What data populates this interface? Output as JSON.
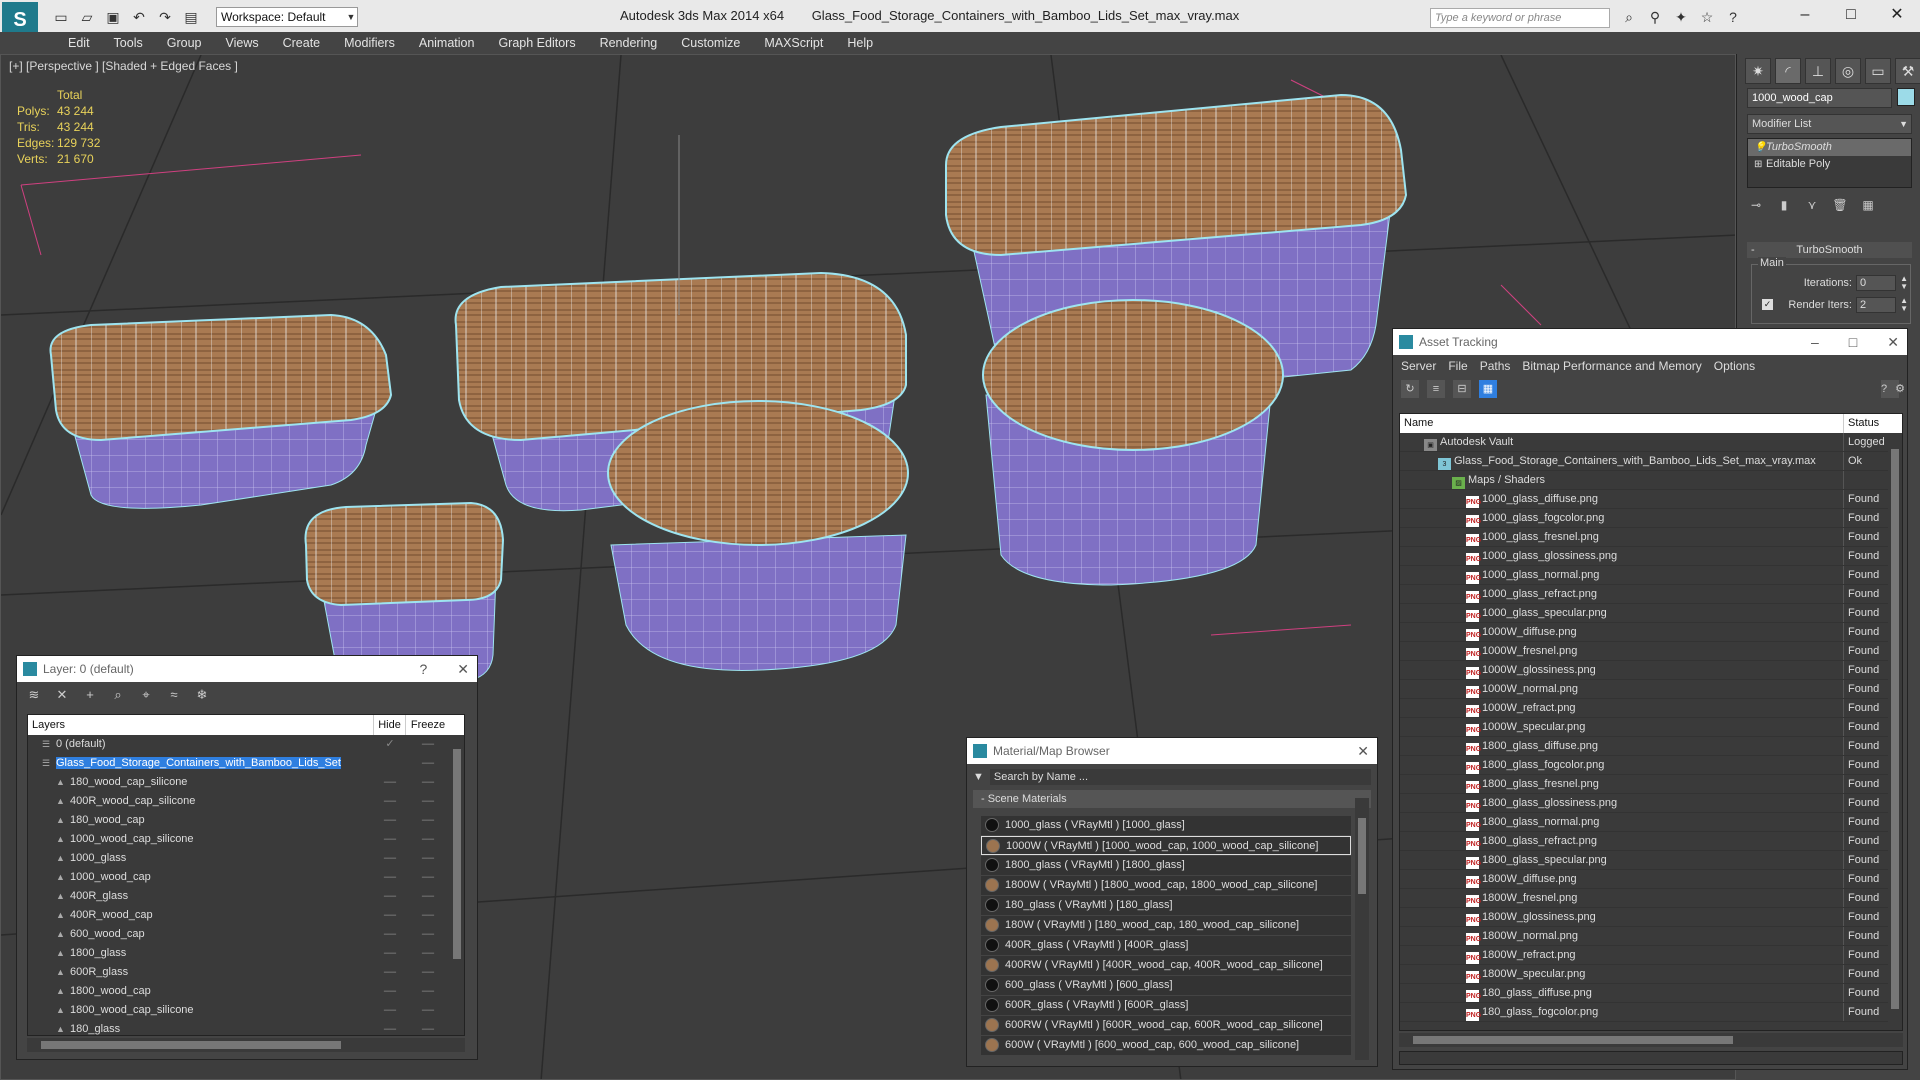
{
  "titlebar": {
    "workspace": "Workspace: Default",
    "app_title": "Autodesk 3ds Max  2014 x64",
    "file_title": "Glass_Food_Storage_Containers_with_Bamboo_Lids_Set_max_vray.max",
    "search_placeholder": "Type a keyword or phrase"
  },
  "menu": [
    "Edit",
    "Tools",
    "Group",
    "Views",
    "Create",
    "Modifiers",
    "Animation",
    "Graph Editors",
    "Rendering",
    "Customize",
    "MAXScript",
    "Help"
  ],
  "viewport": {
    "label": "[+] [Perspective ] [Shaded + Edged Faces ]",
    "stats_header": "Total",
    "stats": [
      {
        "k": "Polys:",
        "v": "43 244"
      },
      {
        "k": "Tris:",
        "v": "43 244"
      },
      {
        "k": "Edges:",
        "v": "129 732"
      },
      {
        "k": "Verts:",
        "v": "21 670"
      }
    ]
  },
  "command_panel": {
    "object_name": "1000_wood_cap",
    "object_color": "#9cdbe8",
    "modifier_list": "Modifier List",
    "stack": [
      "TurboSmooth",
      "Editable Poly"
    ],
    "rollout": "TurboSmooth",
    "group": "Main",
    "iterations_label": "Iterations:",
    "iterations": "0",
    "render_iters_label": "Render Iters:",
    "render_iters": "2"
  },
  "layer_window": {
    "title": "Layer: 0 (default)",
    "help": "?",
    "close": "✕",
    "col_layers": "Layers",
    "col_hide": "Hide",
    "col_freeze": "Freeze",
    "rows": [
      {
        "name": "0 (default)",
        "level": 1,
        "hide": "✓",
        "freeze": ""
      },
      {
        "name": "Glass_Food_Storage_Containers_with_Bamboo_Lids_Set",
        "level": 1,
        "selected": true,
        "hide": "",
        "freeze": ""
      },
      {
        "name": "180_wood_cap_silicone",
        "level": 2
      },
      {
        "name": "400R_wood_cap_silicone",
        "level": 2
      },
      {
        "name": "180_wood_cap",
        "level": 2
      },
      {
        "name": "1000_wood_cap_silicone",
        "level": 2
      },
      {
        "name": "1000_glass",
        "level": 2
      },
      {
        "name": "1000_wood_cap",
        "level": 2
      },
      {
        "name": "400R_glass",
        "level": 2
      },
      {
        "name": "400R_wood_cap",
        "level": 2
      },
      {
        "name": "600_wood_cap",
        "level": 2
      },
      {
        "name": "1800_glass",
        "level": 2
      },
      {
        "name": "600R_glass",
        "level": 2
      },
      {
        "name": "1800_wood_cap",
        "level": 2
      },
      {
        "name": "1800_wood_cap_silicone",
        "level": 2
      },
      {
        "name": "180_glass",
        "level": 2
      }
    ]
  },
  "material_browser": {
    "title": "Material/Map Browser",
    "search": "Search by Name ...",
    "section": "- Scene Materials",
    "items": [
      {
        "label": "1000_glass  ( VRayMtl ) [1000_glass]",
        "wood": false
      },
      {
        "label": "1000W  ( VRayMtl ) [1000_wood_cap, 1000_wood_cap_silicone]",
        "wood": true,
        "selected": true
      },
      {
        "label": "1800_glass  ( VRayMtl ) [1800_glass]",
        "wood": false
      },
      {
        "label": "1800W  ( VRayMtl ) [1800_wood_cap, 1800_wood_cap_silicone]",
        "wood": true
      },
      {
        "label": "180_glass  ( VRayMtl ) [180_glass]",
        "wood": false
      },
      {
        "label": "180W  ( VRayMtl ) [180_wood_cap, 180_wood_cap_silicone]",
        "wood": true
      },
      {
        "label": "400R_glass  ( VRayMtl ) [400R_glass]",
        "wood": false
      },
      {
        "label": "400RW  ( VRayMtl ) [400R_wood_cap, 400R_wood_cap_silicone]",
        "wood": true
      },
      {
        "label": "600_glass  ( VRayMtl ) [600_glass]",
        "wood": false
      },
      {
        "label": "600R_glass  ( VRayMtl ) [600R_glass]",
        "wood": false
      },
      {
        "label": "600RW  ( VRayMtl ) [600R_wood_cap, 600R_wood_cap_silicone]",
        "wood": true
      },
      {
        "label": "600W  ( VRayMtl ) [600_wood_cap, 600_wood_cap_silicone]",
        "wood": true
      }
    ]
  },
  "asset_tracking": {
    "title": "Asset Tracking",
    "menu": [
      "Server",
      "File",
      "Paths",
      "Bitmap Performance and Memory",
      "Options"
    ],
    "col_name": "Name",
    "col_status": "Status",
    "rows": [
      {
        "name": "Autodesk Vault",
        "status": "Logged",
        "level": 1,
        "icon": "vault"
      },
      {
        "name": "Glass_Food_Storage_Containers_with_Bamboo_Lids_Set_max_vray.max",
        "status": "Ok",
        "level": 2,
        "icon": "file"
      },
      {
        "name": "Maps / Shaders",
        "status": "",
        "level": 3,
        "icon": "maps"
      },
      {
        "name": "1000_glass_diffuse.png",
        "status": "Found",
        "level": 4,
        "icon": "png"
      },
      {
        "name": "1000_glass_fogcolor.png",
        "status": "Found",
        "level": 4,
        "icon": "png"
      },
      {
        "name": "1000_glass_fresnel.png",
        "status": "Found",
        "level": 4,
        "icon": "png"
      },
      {
        "name": "1000_glass_glossiness.png",
        "status": "Found",
        "level": 4,
        "icon": "png"
      },
      {
        "name": "1000_glass_normal.png",
        "status": "Found",
        "level": 4,
        "icon": "png"
      },
      {
        "name": "1000_glass_refract.png",
        "status": "Found",
        "level": 4,
        "icon": "png"
      },
      {
        "name": "1000_glass_specular.png",
        "status": "Found",
        "level": 4,
        "icon": "png"
      },
      {
        "name": "1000W_diffuse.png",
        "status": "Found",
        "level": 4,
        "icon": "png"
      },
      {
        "name": "1000W_fresnel.png",
        "status": "Found",
        "level": 4,
        "icon": "png"
      },
      {
        "name": "1000W_glossiness.png",
        "status": "Found",
        "level": 4,
        "icon": "png"
      },
      {
        "name": "1000W_normal.png",
        "status": "Found",
        "level": 4,
        "icon": "png"
      },
      {
        "name": "1000W_refract.png",
        "status": "Found",
        "level": 4,
        "icon": "png"
      },
      {
        "name": "1000W_specular.png",
        "status": "Found",
        "level": 4,
        "icon": "png"
      },
      {
        "name": "1800_glass_diffuse.png",
        "status": "Found",
        "level": 4,
        "icon": "png"
      },
      {
        "name": "1800_glass_fogcolor.png",
        "status": "Found",
        "level": 4,
        "icon": "png"
      },
      {
        "name": "1800_glass_fresnel.png",
        "status": "Found",
        "level": 4,
        "icon": "png"
      },
      {
        "name": "1800_glass_glossiness.png",
        "status": "Found",
        "level": 4,
        "icon": "png"
      },
      {
        "name": "1800_glass_normal.png",
        "status": "Found",
        "level": 4,
        "icon": "png"
      },
      {
        "name": "1800_glass_refract.png",
        "status": "Found",
        "level": 4,
        "icon": "png"
      },
      {
        "name": "1800_glass_specular.png",
        "status": "Found",
        "level": 4,
        "icon": "png"
      },
      {
        "name": "1800W_diffuse.png",
        "status": "Found",
        "level": 4,
        "icon": "png"
      },
      {
        "name": "1800W_fresnel.png",
        "status": "Found",
        "level": 4,
        "icon": "png"
      },
      {
        "name": "1800W_glossiness.png",
        "status": "Found",
        "level": 4,
        "icon": "png"
      },
      {
        "name": "1800W_normal.png",
        "status": "Found",
        "level": 4,
        "icon": "png"
      },
      {
        "name": "1800W_refract.png",
        "status": "Found",
        "level": 4,
        "icon": "png"
      },
      {
        "name": "1800W_specular.png",
        "status": "Found",
        "level": 4,
        "icon": "png"
      },
      {
        "name": "180_glass_diffuse.png",
        "status": "Found",
        "level": 4,
        "icon": "png"
      },
      {
        "name": "180_glass_fogcolor.png",
        "status": "Found",
        "level": 4,
        "icon": "png"
      }
    ]
  }
}
